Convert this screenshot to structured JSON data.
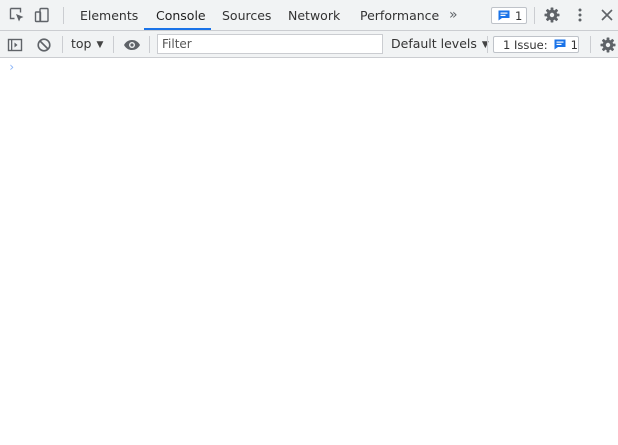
{
  "tabs": [
    {
      "label": "Elements"
    },
    {
      "label": "Console"
    },
    {
      "label": "Sources"
    },
    {
      "label": "Network"
    },
    {
      "label": "Performance"
    }
  ],
  "more_tabs_glyph": "»",
  "issues_badge_count": "1",
  "toolbar": {
    "context_label": "top",
    "filter_placeholder": "Filter",
    "levels_label": "Default levels",
    "issues_label": "1 Issue:",
    "issues_count": "1"
  },
  "prompt_glyph": "›",
  "colors": {
    "accent": "#1a73e8",
    "icon": "#5f6368",
    "toolbar_bg": "#f1f3f4",
    "prompt": "#8ab4f8"
  }
}
